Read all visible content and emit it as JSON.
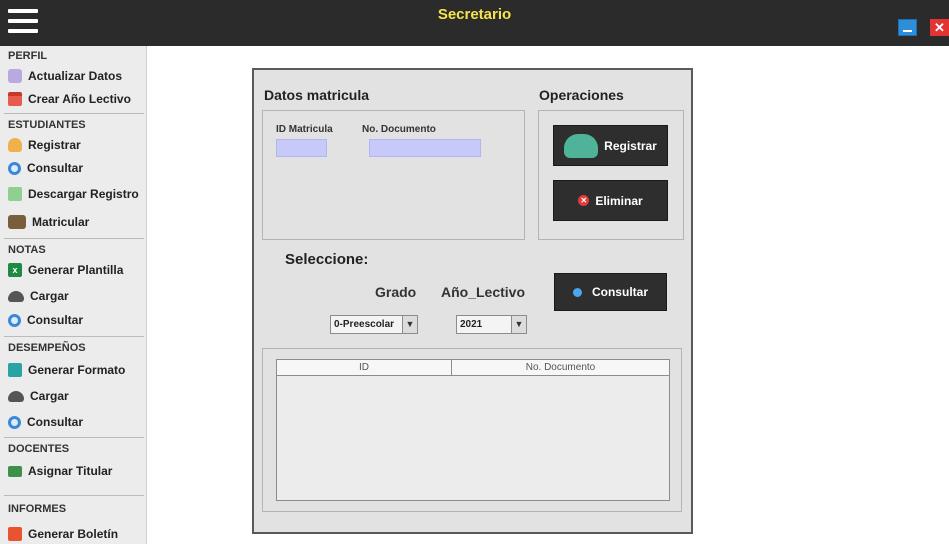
{
  "window": {
    "title": "Secretario",
    "minimize_icon": "minimize-icon",
    "close_label": "✕"
  },
  "sidebar": {
    "sections": [
      {
        "title": "PERFIL",
        "items": [
          {
            "label": "Actualizar Datos",
            "icon": "user-edit-icon"
          },
          {
            "label": "Crear Año Lectivo",
            "icon": "calendar-icon"
          }
        ]
      },
      {
        "title": "ESTUDIANTES",
        "items": [
          {
            "label": "Registrar",
            "icon": "person-icon"
          },
          {
            "label": "Consultar",
            "icon": "search-icon"
          },
          {
            "label": "Descargar Registro",
            "icon": "download-icon"
          },
          {
            "label": "Matricular",
            "icon": "group-icon"
          }
        ]
      },
      {
        "title": "NOTAS",
        "items": [
          {
            "label": "Generar Plantilla",
            "icon": "excel-icon"
          },
          {
            "label": "Cargar",
            "icon": "cloud-upload-icon"
          },
          {
            "label": "Consultar",
            "icon": "search-icon"
          }
        ]
      },
      {
        "title": "DESEMPEÑOS",
        "items": [
          {
            "label": "Generar Formato",
            "icon": "calculator-icon"
          },
          {
            "label": "Cargar",
            "icon": "cloud-upload-icon"
          },
          {
            "label": "Consultar",
            "icon": "search-icon"
          }
        ]
      },
      {
        "title": "DOCENTES",
        "items": [
          {
            "label": "Asignar Titular",
            "icon": "flag-icon"
          }
        ]
      },
      {
        "title": "INFORMES",
        "items": [
          {
            "label": "Generar Boletín",
            "icon": "pdf-icon"
          }
        ]
      }
    ]
  },
  "matricula": {
    "title": "Datos matricula",
    "id_label": "ID Matricula",
    "id_value": "",
    "doc_label": "No. Documento",
    "doc_value": ""
  },
  "operaciones": {
    "title": "Operaciones",
    "registrar": "Registrar",
    "eliminar": "Eliminar"
  },
  "filtros": {
    "title": "Seleccione:",
    "grado_label": "Grado",
    "grado_value": "0-Preescolar",
    "anio_label": "Año_Lectivo",
    "anio_value": "2021",
    "consultar": "Consultar"
  },
  "tabla": {
    "columns": [
      "ID",
      "No. Documento"
    ],
    "rows": []
  }
}
